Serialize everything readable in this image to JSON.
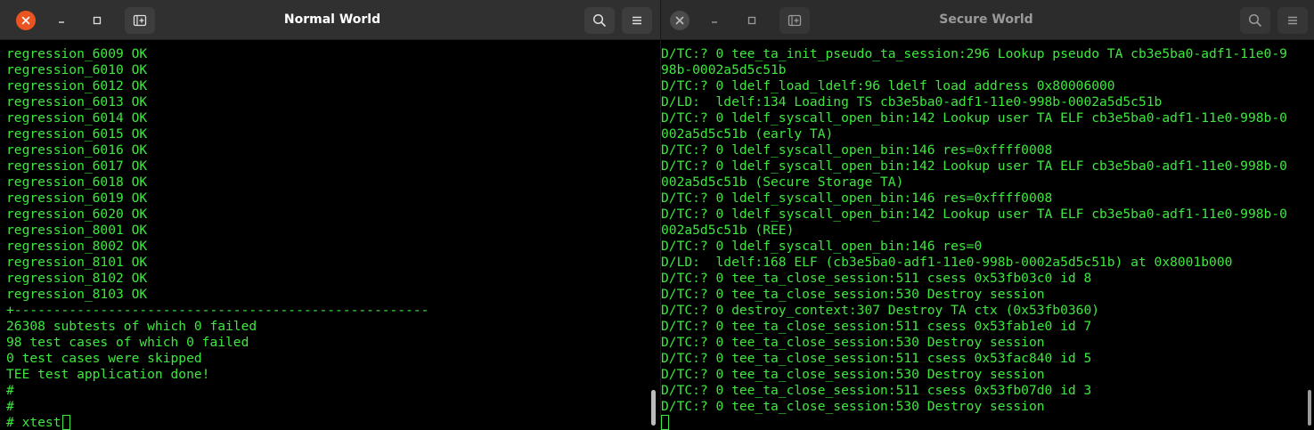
{
  "left_window": {
    "title": "Normal World",
    "focused": true,
    "close_color": "#e95420",
    "text_color": "#3ee83e",
    "lines": [
      "regression_6009 OK",
      "regression_6010 OK",
      "regression_6012 OK",
      "regression_6013 OK",
      "regression_6014 OK",
      "regression_6015 OK",
      "regression_6016 OK",
      "regression_6017 OK",
      "regression_6018 OK",
      "regression_6019 OK",
      "regression_6020 OK",
      "regression_8001 OK",
      "regression_8002 OK",
      "regression_8101 OK",
      "regression_8102 OK",
      "regression_8103 OK",
      "+-----------------------------------------------------",
      "26308 subtests of which 0 failed",
      "98 test cases of which 0 failed",
      "0 test cases were skipped",
      "TEE test application done!",
      "#",
      "#"
    ],
    "prompt": "# xtest"
  },
  "right_window": {
    "title": "Secure World",
    "focused": false,
    "text_color": "#3ee83e",
    "lines": [
      "D/TC:? 0 tee_ta_init_pseudo_ta_session:296 Lookup pseudo TA cb3e5ba0-adf1-11e0-9",
      "98b-0002a5d5c51b",
      "D/TC:? 0 ldelf_load_ldelf:96 ldelf load address 0x80006000",
      "D/LD:  ldelf:134 Loading TS cb3e5ba0-adf1-11e0-998b-0002a5d5c51b",
      "D/TC:? 0 ldelf_syscall_open_bin:142 Lookup user TA ELF cb3e5ba0-adf1-11e0-998b-0",
      "002a5d5c51b (early TA)",
      "D/TC:? 0 ldelf_syscall_open_bin:146 res=0xffff0008",
      "D/TC:? 0 ldelf_syscall_open_bin:142 Lookup user TA ELF cb3e5ba0-adf1-11e0-998b-0",
      "002a5d5c51b (Secure Storage TA)",
      "D/TC:? 0 ldelf_syscall_open_bin:146 res=0xffff0008",
      "D/TC:? 0 ldelf_syscall_open_bin:142 Lookup user TA ELF cb3e5ba0-adf1-11e0-998b-0",
      "002a5d5c51b (REE)",
      "D/TC:? 0 ldelf_syscall_open_bin:146 res=0",
      "D/LD:  ldelf:168 ELF (cb3e5ba0-adf1-11e0-998b-0002a5d5c51b) at 0x8001b000",
      "D/TC:? 0 tee_ta_close_session:511 csess 0x53fb03c0 id 8",
      "D/TC:? 0 tee_ta_close_session:530 Destroy session",
      "D/TC:? 0 destroy_context:307 Destroy TA ctx (0x53fb0360)",
      "D/TC:? 0 tee_ta_close_session:511 csess 0x53fab1e0 id 7",
      "D/TC:? 0 tee_ta_close_session:530 Destroy session",
      "D/TC:? 0 tee_ta_close_session:511 csess 0x53fac840 id 5",
      "D/TC:? 0 tee_ta_close_session:530 Destroy session",
      "D/TC:? 0 tee_ta_close_session:511 csess 0x53fb07d0 id 3",
      "D/TC:? 0 tee_ta_close_session:530 Destroy session"
    ]
  }
}
